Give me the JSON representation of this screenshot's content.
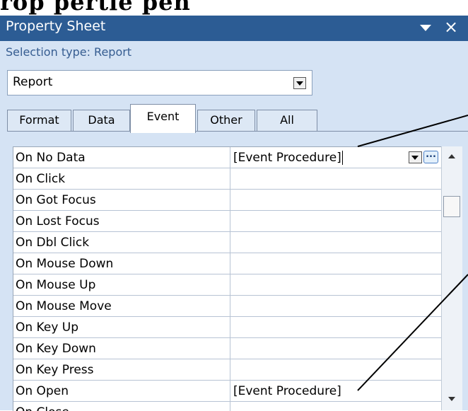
{
  "header_clip": {
    "text": "rop         pertie         pen"
  },
  "window": {
    "title": "Property Sheet",
    "pin_icon": "dropdown-triangle-icon",
    "close_glyph": "×"
  },
  "selection": {
    "label": "Selection type:  Report"
  },
  "object_combo": {
    "value": "Report"
  },
  "tabs": [
    {
      "label": "Format"
    },
    {
      "label": "Data"
    },
    {
      "label": "Event"
    },
    {
      "label": "Other"
    },
    {
      "label": "All"
    }
  ],
  "active_tab": "Event",
  "properties": [
    {
      "name": "On No Data",
      "value": "[Event Procedure]"
    },
    {
      "name": "On Click",
      "value": ""
    },
    {
      "name": "On Got Focus",
      "value": ""
    },
    {
      "name": "On Lost Focus",
      "value": ""
    },
    {
      "name": "On Dbl Click",
      "value": ""
    },
    {
      "name": "On Mouse Down",
      "value": ""
    },
    {
      "name": "On Mouse Up",
      "value": ""
    },
    {
      "name": "On Mouse Move",
      "value": ""
    },
    {
      "name": "On Key Up",
      "value": ""
    },
    {
      "name": "On Key Down",
      "value": ""
    },
    {
      "name": "On Key Press",
      "value": ""
    },
    {
      "name": "On Open",
      "value": "[Event Procedure]"
    },
    {
      "name": "On Close",
      "value": ""
    }
  ],
  "build_button": {
    "glyph": "..."
  },
  "colors": {
    "titlebar": "#2c5c94",
    "panel": "#d5e3f4",
    "selection_text": "#365d91"
  }
}
